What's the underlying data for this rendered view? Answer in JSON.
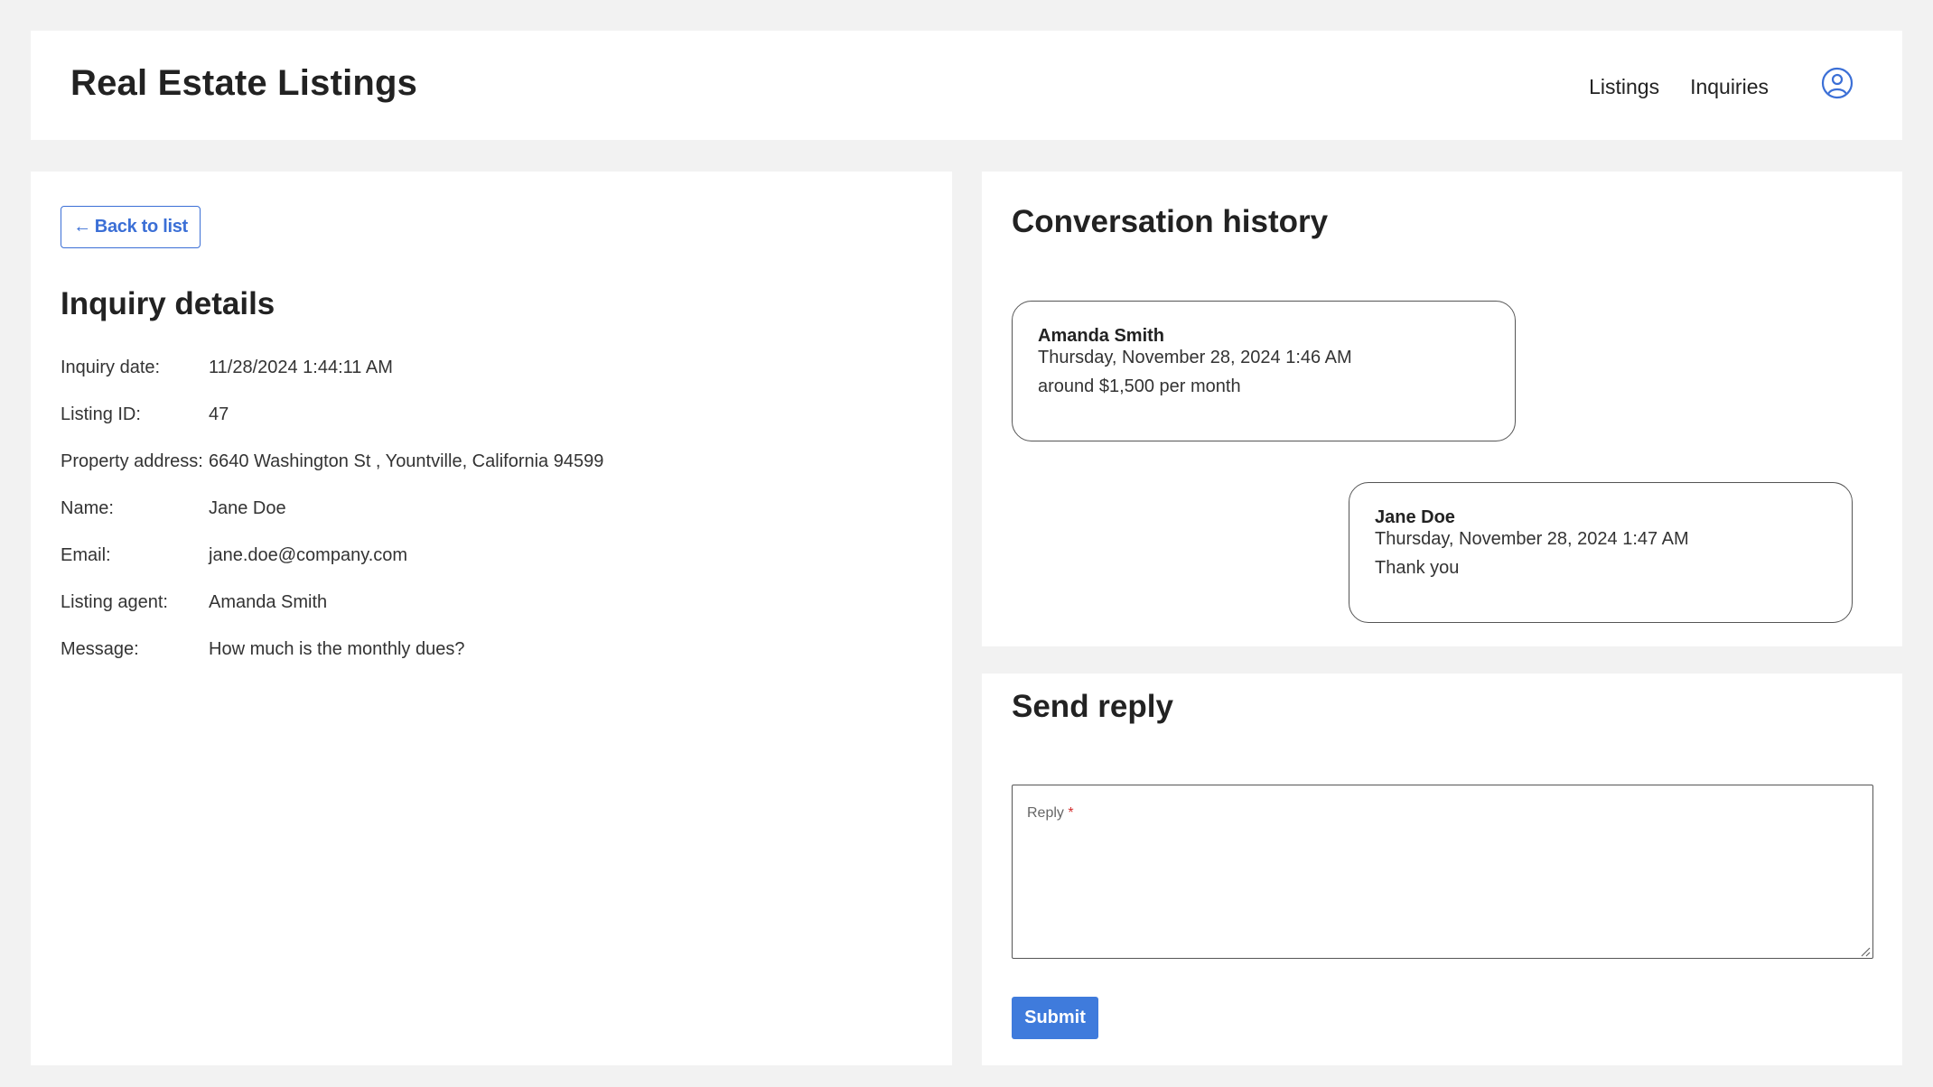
{
  "header": {
    "title": "Real Estate Listings",
    "nav": [
      "Listings",
      "Inquiries"
    ],
    "account_icon": "user-circle-icon"
  },
  "inquiry": {
    "back_label": "Back to list",
    "back_arrow": "←",
    "title": "Inquiry details",
    "rows": [
      {
        "label": "Inquiry date:",
        "value": "11/28/2024 1:44:11 AM"
      },
      {
        "label": "Listing ID:",
        "value": "47"
      },
      {
        "label": "Property address:",
        "value": "6640 Washington St , Yountville, California 94599"
      },
      {
        "label": "Name:",
        "value": "Jane Doe"
      },
      {
        "label": "Email:",
        "value": "jane.doe@company.com"
      },
      {
        "label": "Listing agent:",
        "value": "Amanda Smith"
      },
      {
        "label": "Message:",
        "value": "How much is the monthly dues?"
      }
    ]
  },
  "conversation": {
    "title": "Conversation history",
    "messages": [
      {
        "sender": "Amanda Smith",
        "time": "Thursday, November 28, 2024 1:46 AM",
        "text": "around $1,500 per month"
      },
      {
        "sender": "Jane Doe",
        "time": "Thursday, November 28, 2024 1:47 AM",
        "text": "Thank you"
      }
    ]
  },
  "reply": {
    "title": "Send reply",
    "field_label": "Reply",
    "required_mark": "*",
    "submit_label": "Submit"
  },
  "colors": {
    "accent": "#3f7bdc",
    "background": "#f2f2f2"
  }
}
